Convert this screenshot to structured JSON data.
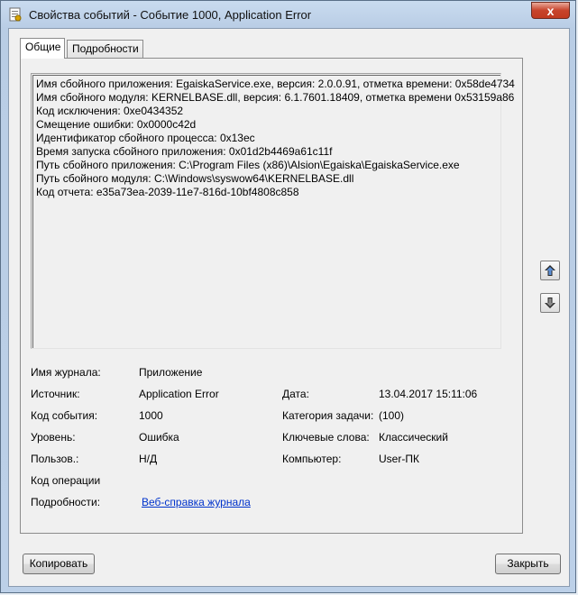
{
  "window": {
    "title": "Свойства событий - Событие 1000, Application Error",
    "close_glyph": "x"
  },
  "tabs": [
    {
      "label": "Общие"
    },
    {
      "label": "Подробности"
    }
  ],
  "description_lines": [
    "Имя сбойного приложения: EgaiskaService.exe, версия: 2.0.0.91, отметка времени: 0x58de4734",
    "Имя сбойного модуля: KERNELBASE.dll, версия: 6.1.7601.18409, отметка времени 0x53159a86",
    "Код исключения: 0xe0434352",
    "Смещение ошибки: 0x0000c42d",
    "Идентификатор сбойного процесса: 0x13ec",
    "Время запуска сбойного приложения: 0x01d2b4469a61c11f",
    "Путь сбойного приложения: C:\\Program Files (x86)\\Alsion\\Egaiska\\EgaiskaService.exe",
    "Путь сбойного модуля: C:\\Windows\\syswow64\\KERNELBASE.dll",
    "Код отчета: e35a73ea-2039-11e7-816d-10bf4808c858"
  ],
  "fields": {
    "log_name_label": "Имя журнала:",
    "log_name_value": "Приложение",
    "source_label": "Источник:",
    "source_value": "Application Error",
    "date_label": "Дата:",
    "date_value": "13.04.2017 15:11:06",
    "event_id_label": "Код события:",
    "event_id_value": "1000",
    "task_category_label": "Категория задачи:",
    "task_category_value": "(100)",
    "level_label": "Уровень:",
    "level_value": "Ошибка",
    "keywords_label": "Ключевые слова:",
    "keywords_value": "Классический",
    "user_label": "Пользов.:",
    "user_value": "Н/Д",
    "computer_label": "Компьютер:",
    "computer_value": "User-ПК",
    "opcode_label": "Код операции",
    "details_label": "Подробности:",
    "details_link": "Веб-справка журнала"
  },
  "buttons": {
    "copy": "Копировать",
    "close": "Закрыть"
  }
}
